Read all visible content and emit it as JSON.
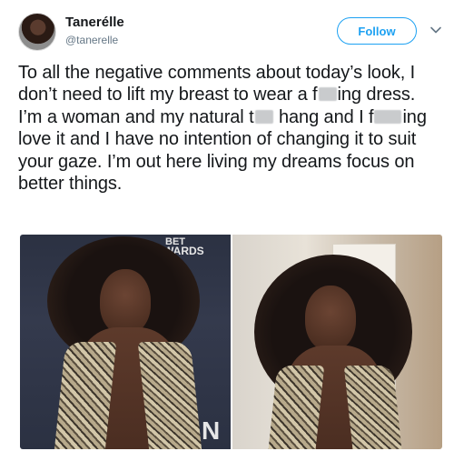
{
  "tweet": {
    "display_name": "Tanerélle",
    "handle": "@tanerelle",
    "follow_label": "Follow",
    "chevron_icon": "chevron-down-icon",
    "text_parts": {
      "p1": "To all the negative comments about today’s look, I don’t need to lift my breast to wear a f",
      "p2": "ing dress. I’m a woman and my natural t",
      "p3": " hang and I f",
      "p4": "ing love it and I have no intention of changing it to suit your gaze. I’m out here living my dreams focus on better things."
    }
  },
  "media": {
    "left_photo": {
      "backdrop_text_1": "BET",
      "backdrop_text_2": "WARDS",
      "backdrop_text_3": "N"
    }
  },
  "colors": {
    "accent": "#1da1f2",
    "text": "#14171a",
    "secondary": "#657786"
  }
}
